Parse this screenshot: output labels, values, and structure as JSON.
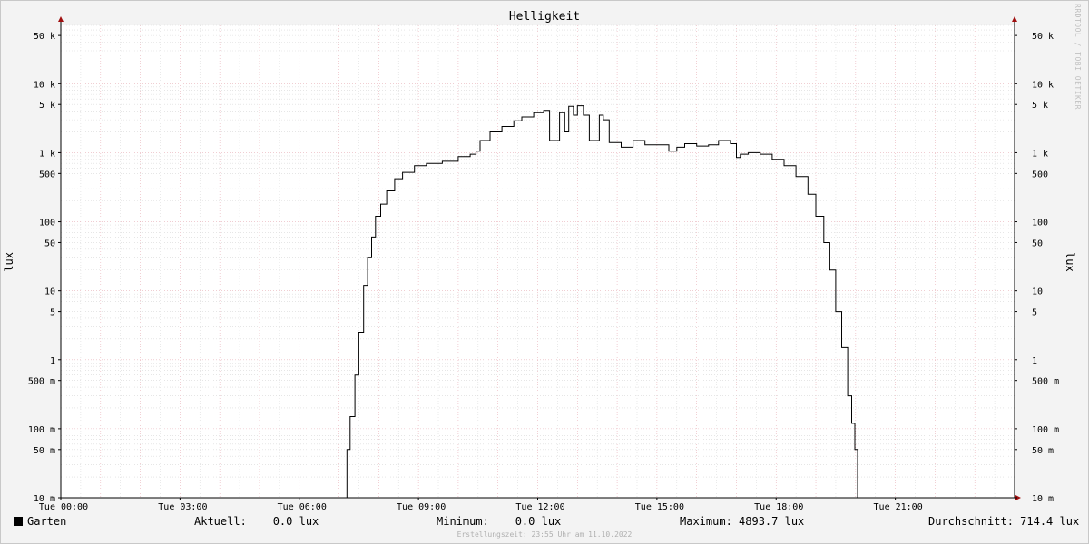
{
  "watermark": "RRDTOOL / TOBI OETIKER",
  "chart_data": {
    "type": "line",
    "title": "Helligkeit",
    "ylabel": "lux",
    "y_scale": "log",
    "ylim": [
      0.01,
      70000
    ],
    "xlim_hours": [
      0,
      24
    ],
    "grid": true,
    "y_ticks": [
      {
        "value": 50000,
        "label": "50 k"
      },
      {
        "value": 10000,
        "label": "10 k"
      },
      {
        "value": 5000,
        "label": "5 k"
      },
      {
        "value": 1000,
        "label": "1 k"
      },
      {
        "value": 500,
        "label": "500"
      },
      {
        "value": 100,
        "label": "100"
      },
      {
        "value": 50,
        "label": "50"
      },
      {
        "value": 10,
        "label": "10"
      },
      {
        "value": 5,
        "label": "5"
      },
      {
        "value": 1,
        "label": "1"
      },
      {
        "value": 0.5,
        "label": "500 m"
      },
      {
        "value": 0.1,
        "label": "100 m"
      },
      {
        "value": 0.05,
        "label": "50 m"
      },
      {
        "value": 0.01,
        "label": "10 m"
      }
    ],
    "x_ticks": [
      {
        "hour": 0,
        "label": "Tue 00:00"
      },
      {
        "hour": 3,
        "label": "Tue 03:00"
      },
      {
        "hour": 6,
        "label": "Tue 06:00"
      },
      {
        "hour": 9,
        "label": "Tue 09:00"
      },
      {
        "hour": 12,
        "label": "Tue 12:00"
      },
      {
        "hour": 15,
        "label": "Tue 15:00"
      },
      {
        "hour": 18,
        "label": "Tue 18:00"
      },
      {
        "hour": 21,
        "label": "Tue 21:00"
      }
    ],
    "series": [
      {
        "name": "Garten",
        "color": "#000000",
        "points": [
          [
            0,
            0.01
          ],
          [
            7.15,
            0.01
          ],
          [
            7.2,
            0.05
          ],
          [
            7.28,
            0.15
          ],
          [
            7.4,
            0.6
          ],
          [
            7.5,
            2.5
          ],
          [
            7.62,
            12
          ],
          [
            7.72,
            30
          ],
          [
            7.82,
            60
          ],
          [
            7.92,
            120
          ],
          [
            8.05,
            180
          ],
          [
            8.2,
            280
          ],
          [
            8.4,
            420
          ],
          [
            8.6,
            520
          ],
          [
            8.9,
            650
          ],
          [
            9.2,
            700
          ],
          [
            9.6,
            750
          ],
          [
            10.0,
            880
          ],
          [
            10.3,
            950
          ],
          [
            10.45,
            1050
          ],
          [
            10.55,
            1500
          ],
          [
            10.8,
            2000
          ],
          [
            11.1,
            2400
          ],
          [
            11.4,
            2900
          ],
          [
            11.6,
            3300
          ],
          [
            11.9,
            3800
          ],
          [
            12.15,
            4100
          ],
          [
            12.3,
            1500
          ],
          [
            12.4,
            1500
          ],
          [
            12.55,
            3800
          ],
          [
            12.68,
            2000
          ],
          [
            12.78,
            4700
          ],
          [
            12.9,
            3500
          ],
          [
            13.0,
            4800
          ],
          [
            13.15,
            3500
          ],
          [
            13.3,
            1500
          ],
          [
            13.4,
            1500
          ],
          [
            13.55,
            3500
          ],
          [
            13.65,
            3000
          ],
          [
            13.8,
            1400
          ],
          [
            14.1,
            1200
          ],
          [
            14.4,
            1500
          ],
          [
            14.7,
            1300
          ],
          [
            15.1,
            1300
          ],
          [
            15.3,
            1050
          ],
          [
            15.5,
            1200
          ],
          [
            15.7,
            1350
          ],
          [
            16.0,
            1250
          ],
          [
            16.3,
            1300
          ],
          [
            16.55,
            1500
          ],
          [
            16.85,
            1350
          ],
          [
            17.0,
            850
          ],
          [
            17.1,
            950
          ],
          [
            17.3,
            1000
          ],
          [
            17.6,
            950
          ],
          [
            17.9,
            800
          ],
          [
            18.2,
            650
          ],
          [
            18.5,
            450
          ],
          [
            18.8,
            250
          ],
          [
            19.0,
            120
          ],
          [
            19.2,
            50
          ],
          [
            19.35,
            20
          ],
          [
            19.5,
            5
          ],
          [
            19.65,
            1.5
          ],
          [
            19.8,
            0.3
          ],
          [
            19.9,
            0.12
          ],
          [
            19.98,
            0.05
          ],
          [
            20.05,
            0.01
          ],
          [
            24,
            0.01
          ]
        ]
      }
    ]
  },
  "legend": {
    "series_name": "Garten",
    "aktuell": "Aktuell:    0.0 lux",
    "minimum": "Minimum:    0.0 lux",
    "maximum": "Maximum: 4893.7 lux",
    "durchschnitt": "Durchschnitt: 714.4 lux"
  },
  "footer": "Erstellungszeit: 23:55 Uhr am 11.10.2022"
}
